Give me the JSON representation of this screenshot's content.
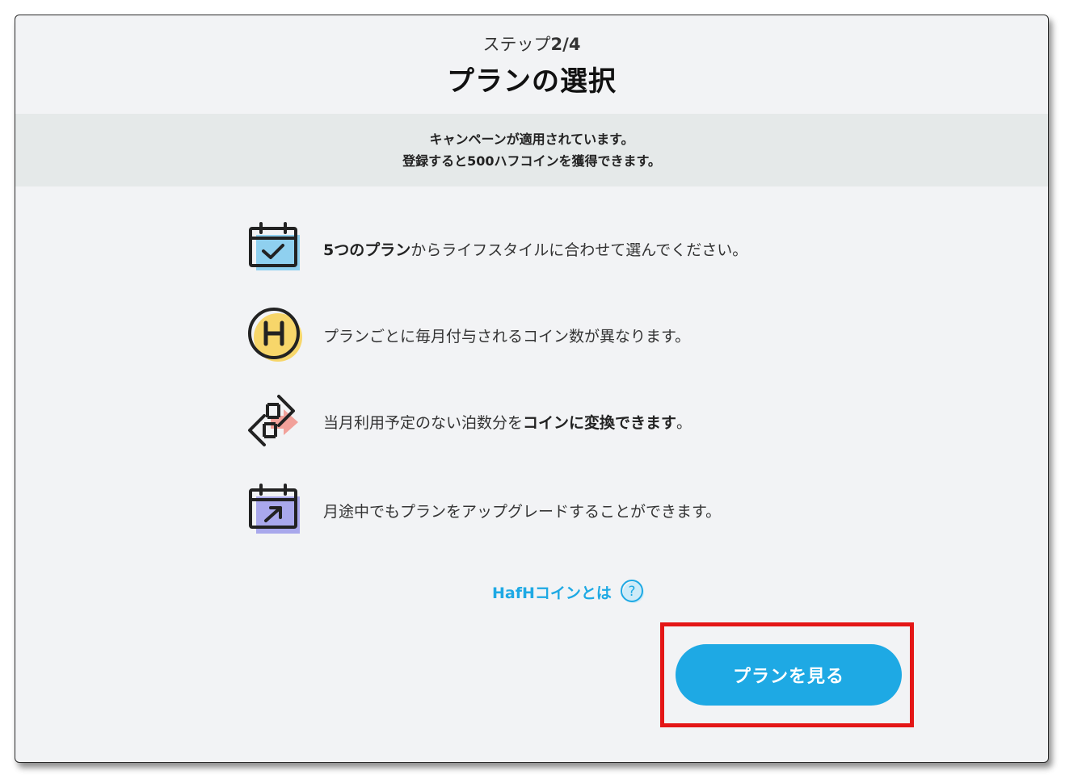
{
  "header": {
    "step_prefix": "ステップ",
    "step_value": "2/4",
    "title": "プランの選択"
  },
  "campaign": {
    "line1": "キャンペーンが適用されています。",
    "line2": "登録すると500ハフコインを獲得できます。"
  },
  "features": [
    {
      "icon": "calendar-check-icon",
      "text_bold": "5つのプラン",
      "text_rest": "からライフスタイルに合わせて選んでください。"
    },
    {
      "icon": "hafh-coin-icon",
      "text": "プランごとに毎月付与されるコイン数が異なります。"
    },
    {
      "icon": "exchange-arrows-icon",
      "text_plain": "当月利用予定のない泊数分を",
      "text_bold": "コインに変換できます",
      "text_end": "。"
    },
    {
      "icon": "calendar-upgrade-icon",
      "text": "月途中でもプランをアップグレードすることができます。"
    }
  ],
  "coin_link": {
    "label": "HafHコインとは"
  },
  "cta": {
    "label": "プランを見る"
  },
  "colors": {
    "accent": "#1ea9e4",
    "highlight": "#e41616",
    "banner_bg": "#e5e9e9",
    "page_bg": "#f2f3f5"
  }
}
